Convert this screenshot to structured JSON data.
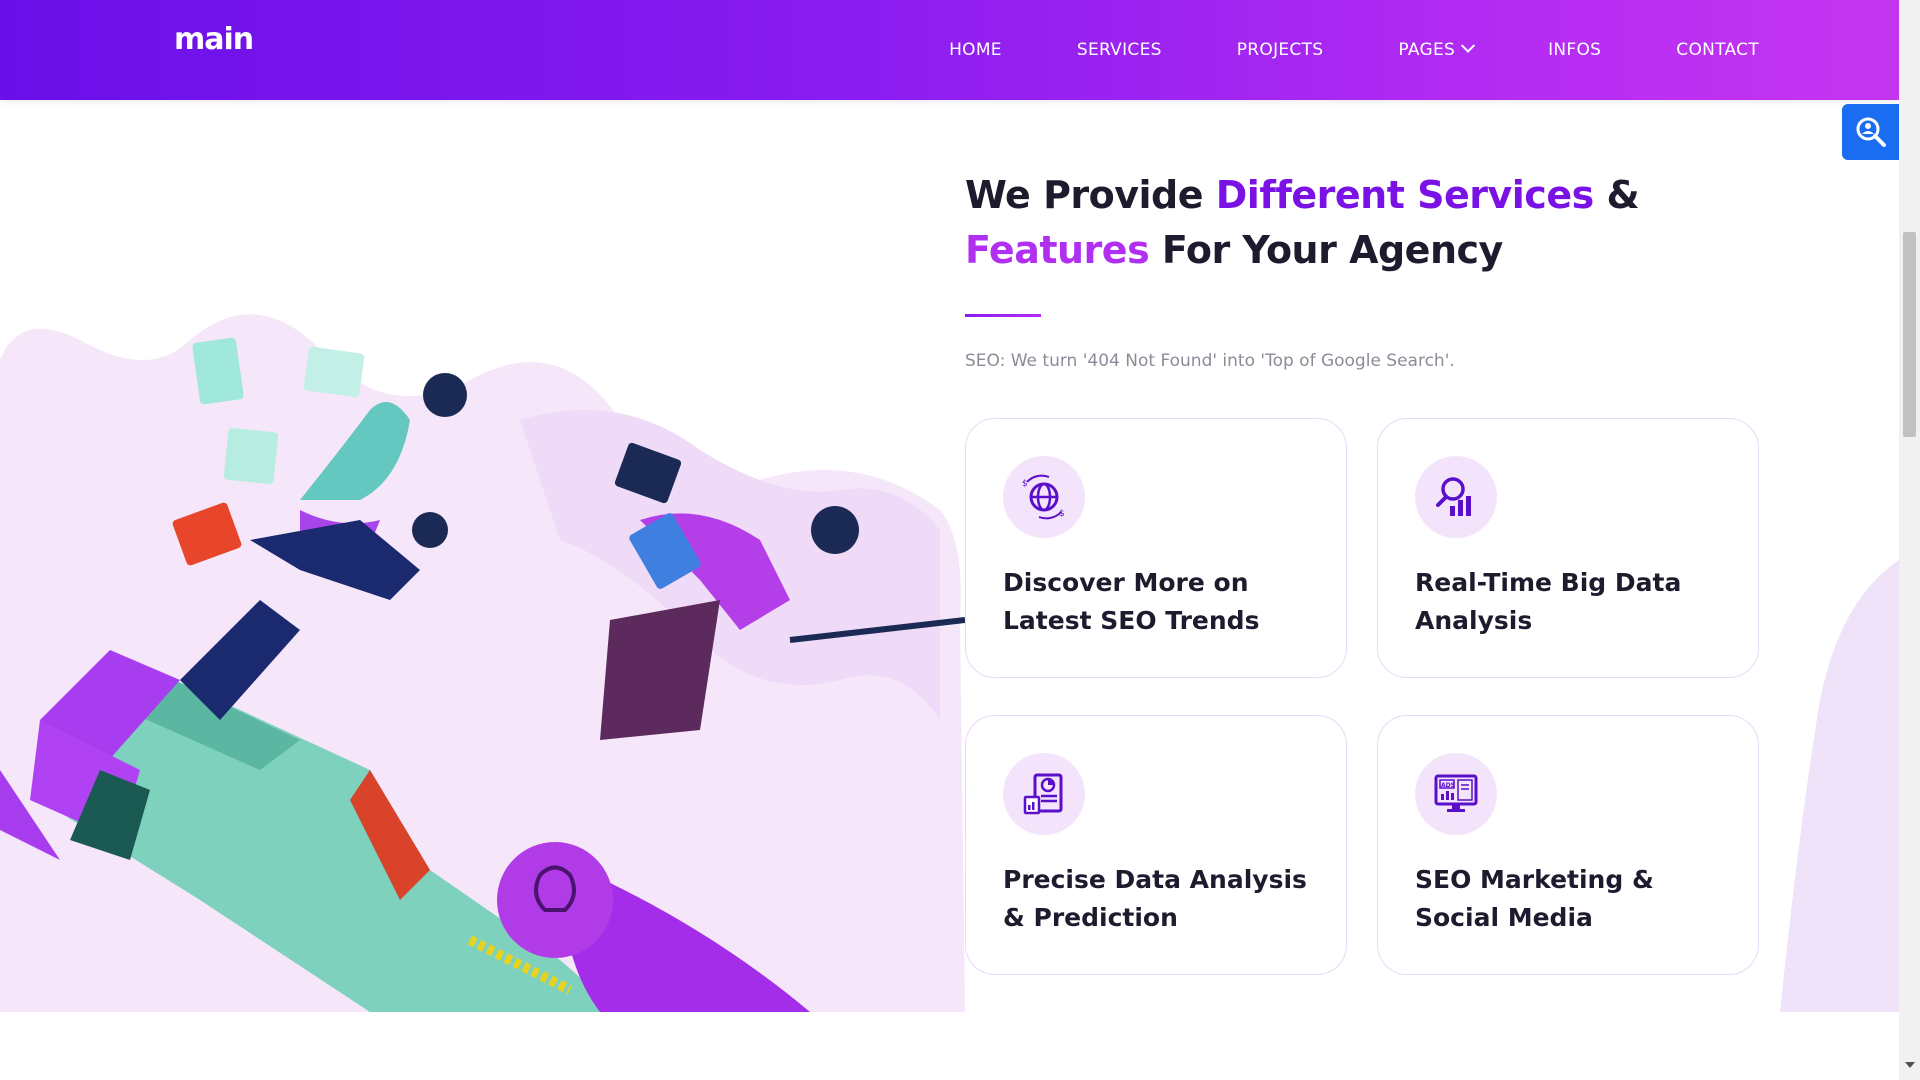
{
  "header": {
    "logo_text": "main",
    "nav": [
      {
        "label": "HOME"
      },
      {
        "label": "SERVICES"
      },
      {
        "label": "PROJECTS"
      },
      {
        "label": "PAGES"
      },
      {
        "label": "INFOS"
      },
      {
        "label": "CONTACT"
      }
    ]
  },
  "floating_widget": {
    "icon": "search-person-icon"
  },
  "section": {
    "heading_part1": "We Provide ",
    "heading_highlight1": "Different Services",
    "heading_part2": " & ",
    "heading_highlight2": "Features",
    "heading_part3": " For Your Agency",
    "subtitle": "SEO: We turn '404 Not Found' into 'Top of Google Search'.",
    "cards": [
      {
        "title": "Discover More on Latest SEO Trends",
        "icon": "globe-dollar-icon"
      },
      {
        "title": "Real-Time Big Data Analysis",
        "icon": "search-chart-icon"
      },
      {
        "title": "Precise Data Analysis & Prediction",
        "icon": "report-chart-icon"
      },
      {
        "title": "SEO Marketing & Social Media",
        "icon": "ads-monitor-icon"
      }
    ]
  },
  "colors": {
    "header_gradient_start": "#6a0fe8",
    "header_gradient_end": "#c435f0",
    "accent_purple": "#7a12e6",
    "accent_magenta": "#b02ff0",
    "widget_blue": "#1a6cf0"
  }
}
